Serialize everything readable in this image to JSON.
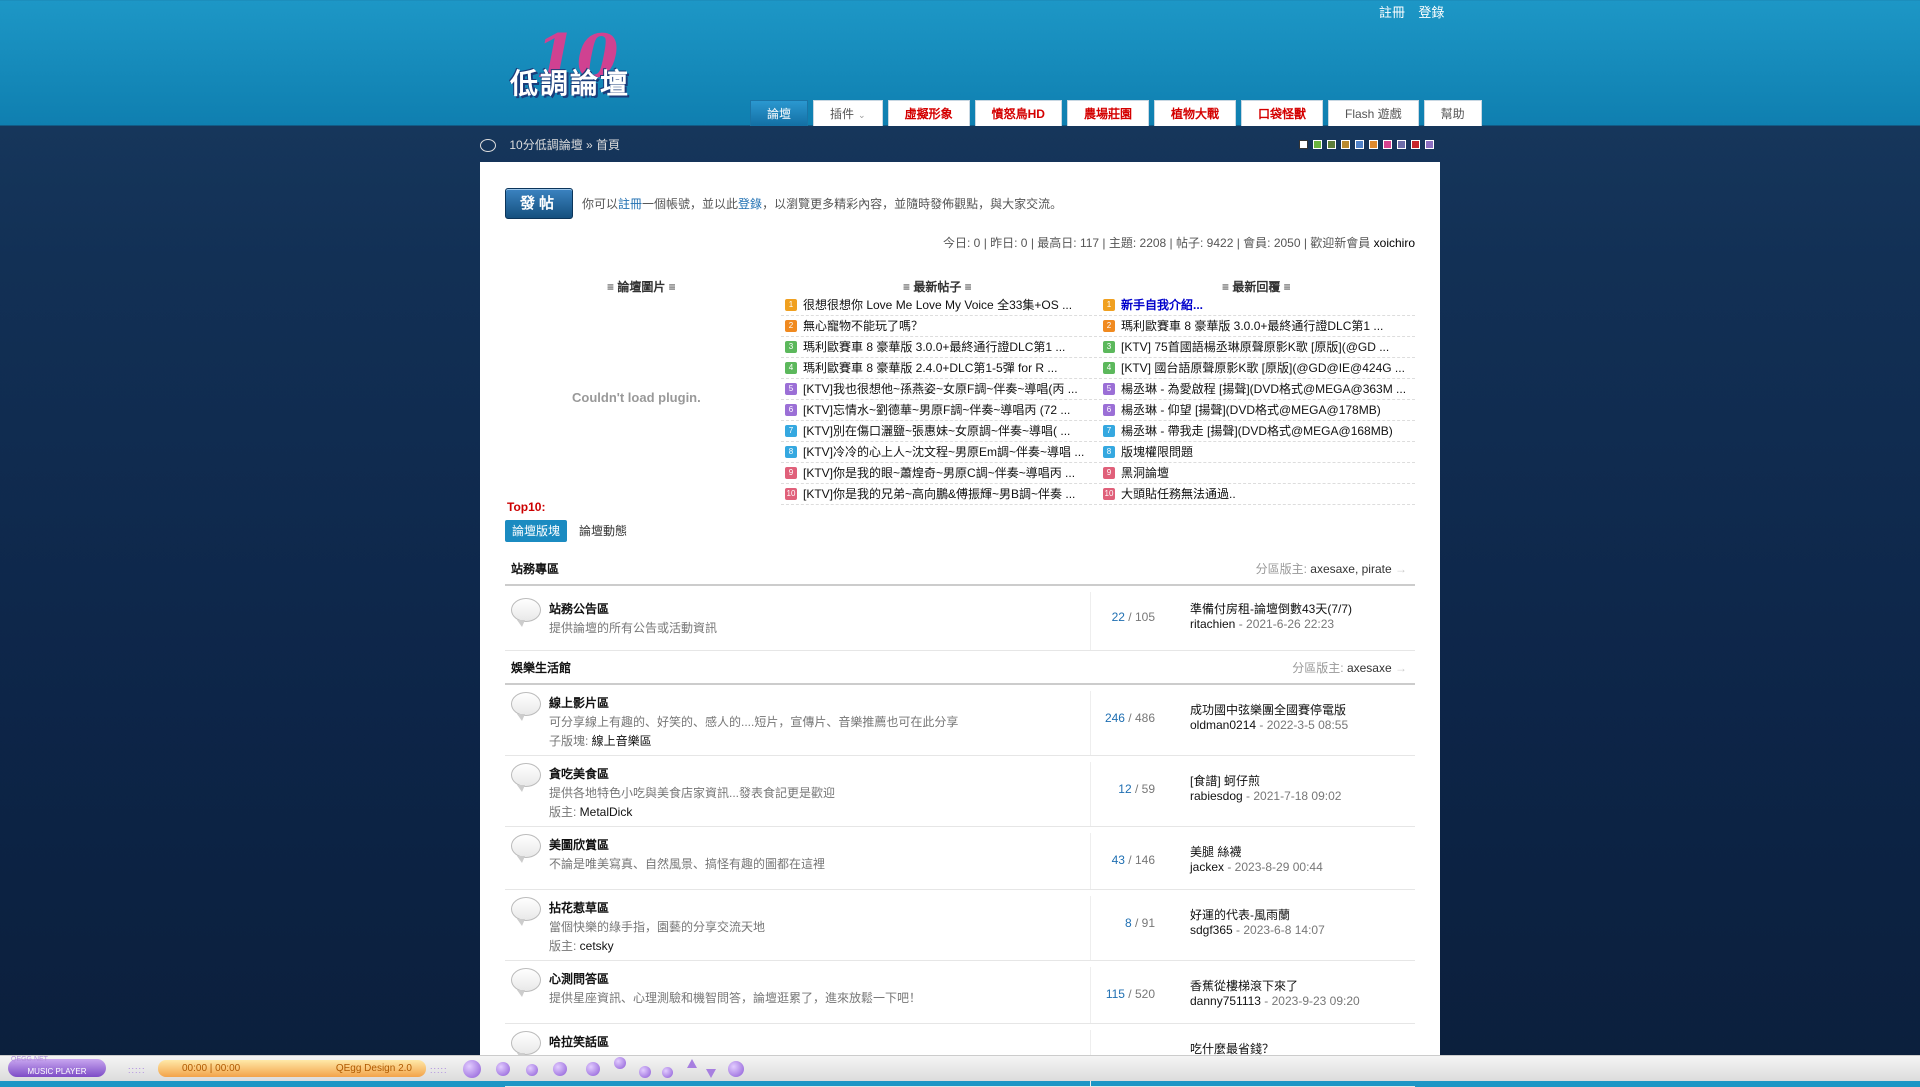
{
  "header": {
    "top_links": [
      "註冊",
      "登錄"
    ],
    "logo_text": "低調論壇",
    "logo_number": "10"
  },
  "nav": {
    "tabs": [
      {
        "label": "論壇",
        "active": true,
        "red": false,
        "caret": false
      },
      {
        "label": "插件",
        "active": false,
        "red": false,
        "caret": true
      },
      {
        "label": "虛擬形象",
        "active": false,
        "red": true,
        "caret": false
      },
      {
        "label": "憤怒鳥HD",
        "active": false,
        "red": true,
        "caret": false
      },
      {
        "label": "農場莊園",
        "active": false,
        "red": true,
        "caret": false
      },
      {
        "label": "植物大戰",
        "active": false,
        "red": true,
        "caret": false
      },
      {
        "label": "口袋怪獸",
        "active": false,
        "red": true,
        "caret": false
      },
      {
        "label": "Flash 遊戲",
        "active": false,
        "red": false,
        "caret": false
      },
      {
        "label": "幫助",
        "active": false,
        "red": false,
        "caret": false
      }
    ]
  },
  "breadcrumb": {
    "text": "10分低調論壇 » 首頁",
    "swatch_colors": [
      "#ffffff",
      "#6ab43e",
      "#5f7f3a",
      "#b98a2e",
      "#4f81c7",
      "#e08a2c",
      "#d6438f",
      "#6d6da8",
      "#c9272b",
      "#8c6fc1"
    ]
  },
  "intro": {
    "post_button": "發帖",
    "welcome_pre": "你可以",
    "register_link": "註冊",
    "welcome_mid": "一個帳號，並以此",
    "login_link": "登錄",
    "welcome_post": "，以瀏覽更多精彩內容，並隨時發佈觀點，與大家交流。",
    "stats": "今日: 0 | 昨日: 0 | 最高日: 117 | 主題: 2208 | 帖子: 9422 | 會員: 2050 | 歡迎新會員 ",
    "newest_member": "xoichiro"
  },
  "widgets": {
    "images_title": "≡ 論壇圖片 ≡",
    "plugin_msg": "Couldn't load plugin.",
    "newest_title": "≡ 最新帖子 ≡",
    "replies_title": "≡ 最新回覆 ≡",
    "newest_posts": [
      "很想很想你 Love Me Love My Voice 全33集+OS ...",
      "無心寵物不能玩了嗎？",
      "瑪利歐賽車 8 豪華版 3.0.0+最終通行證DLC第1 ...",
      "瑪利歐賽車 8 豪華版 2.4.0+DLC第1-5彈 for R ...",
      "[KTV]我也很想他~孫燕姿~女原F調~伴奏~導唱(丙 ...",
      "[KTV]忘情水~劉德華~男原F調~伴奏~導唱丙 (72 ...",
      "[KTV]別在傷口灑鹽~張惠妹~女原調~伴奏~導唱( ...",
      "[KTV]冷冷的心上人~沈文程~男原Em調~伴奏~導唱 ...",
      "[KTV]你是我的眼~蕭煌奇~男原C調~伴奏~導唱丙 ...",
      "[KTV]你是我的兄弟~高向鵬&傅振輝~男B調~伴奏 ..."
    ],
    "newest_replies": [
      "新手自我介紹...",
      "瑪利歐賽車 8 豪華版 3.0.0+最終通行證DLC第1 ...",
      "[KTV] 75首國語楊丞琳原聲原影K歌 [原版](@GD ...",
      "[KTV] 國台語原聲原影K歌 [原版](@GD@IE@424G ...",
      "楊丞琳 - 為愛啟程 [揚聲](DVD格式@MEGA@363M ...",
      "楊丞琳 - 仰望 [揚聲](DVD格式@MEGA@178MB)",
      "楊丞琳 - 帶我走 [揚聲](DVD格式@MEGA@168MB)",
      "版塊權限問題",
      "黑洞論壇",
      "大頭貼任務無法通過.."
    ],
    "number_colors": [
      "#f0a020",
      "#f08a20",
      "#5cb85c",
      "#5cb85c",
      "#9b6fd6",
      "#9b6fd6",
      "#35a8e0",
      "#35a8e0",
      "#e0607a",
      "#e0607a"
    ],
    "top10_label": "Top10:",
    "subtabs": [
      "論壇版塊",
      "論壇動態"
    ]
  },
  "groups": [
    {
      "name": "站務專區",
      "mods_label": "分區版主:",
      "mods": "axesaxe, pirate",
      "arrow": "→",
      "forums": [
        {
          "name": "站務公告區",
          "desc": "提供論壇的所有公告或活動資訊",
          "sub_label": "",
          "sub_value": "",
          "topics": "22",
          "posts": " / 105",
          "last_title": "準備付房租-論壇倒數43天(7/7)",
          "last_user": "ritachien",
          "last_time": " - 2021-6-26 22:23"
        }
      ]
    },
    {
      "name": "娛樂生活館",
      "mods_label": "分區版主:",
      "mods": "axesaxe",
      "arrow": "→",
      "forums": [
        {
          "name": "線上影片區",
          "desc": "可分享線上有趣的、好笑的、感人的....短片，宣傳片、音樂推薦也可在此分享",
          "sub_label": "子版塊: ",
          "sub_value": "線上音樂區",
          "topics": "246",
          "posts": " / 486",
          "last_title": "成功國中弦樂團全國賽停電版",
          "last_user": "oldman0214",
          "last_time": " - 2022-3-5 08:55"
        },
        {
          "name": "貪吃美食區",
          "desc": "提供各地特色小吃與美食店家資訊...發表食記更是歡迎",
          "sub_label": "版主: ",
          "sub_value": "MetalDick",
          "topics": "12",
          "posts": " / 59",
          "last_title": "[食譜] 蚵仔煎",
          "last_user": "rabiesdog",
          "last_time": " - 2021-7-18 09:02"
        },
        {
          "name": "美圖欣賞區",
          "desc": "不論是唯美寫真、自然風景、搞怪有趣的圖都在這裡",
          "sub_label": "",
          "sub_value": "",
          "topics": "43",
          "posts": " / 146",
          "last_title": "美腿 絲襪",
          "last_user": "jackex",
          "last_time": " - 2023-8-29 00:44"
        },
        {
          "name": "拈花惹草區",
          "desc": "當個快樂的綠手指，園藝的分享交流天地",
          "sub_label": "版主: ",
          "sub_value": "cetsky",
          "topics": "8",
          "posts": " / 91",
          "last_title": "好運的代表-風雨蘭",
          "last_user": "sdgf365",
          "last_time": " - 2023-6-8 14:07"
        },
        {
          "name": "心測問答區",
          "desc": "提供星座資訊、心理測驗和機智問答，論壇逛累了，進來放鬆一下吧！",
          "sub_label": "",
          "sub_value": "",
          "topics": "115",
          "posts": " / 520",
          "last_title": "香蕉從樓梯滾下來了",
          "last_user": "danny751113",
          "last_time": " - 2023-9-23 09:20"
        },
        {
          "name": "哈拉笑話區",
          "desc": "",
          "sub_label": "",
          "sub_value": "",
          "topics": "",
          "posts": "",
          "last_title": "吃什麼最省錢？",
          "last_user": "",
          "last_time": ""
        }
      ]
    }
  ],
  "player": {
    "site": "QEGG.NET",
    "brand": "MUSIC PLAYER",
    "time": "00:00 | 00:00",
    "design": "QEgg Design 2.0"
  }
}
